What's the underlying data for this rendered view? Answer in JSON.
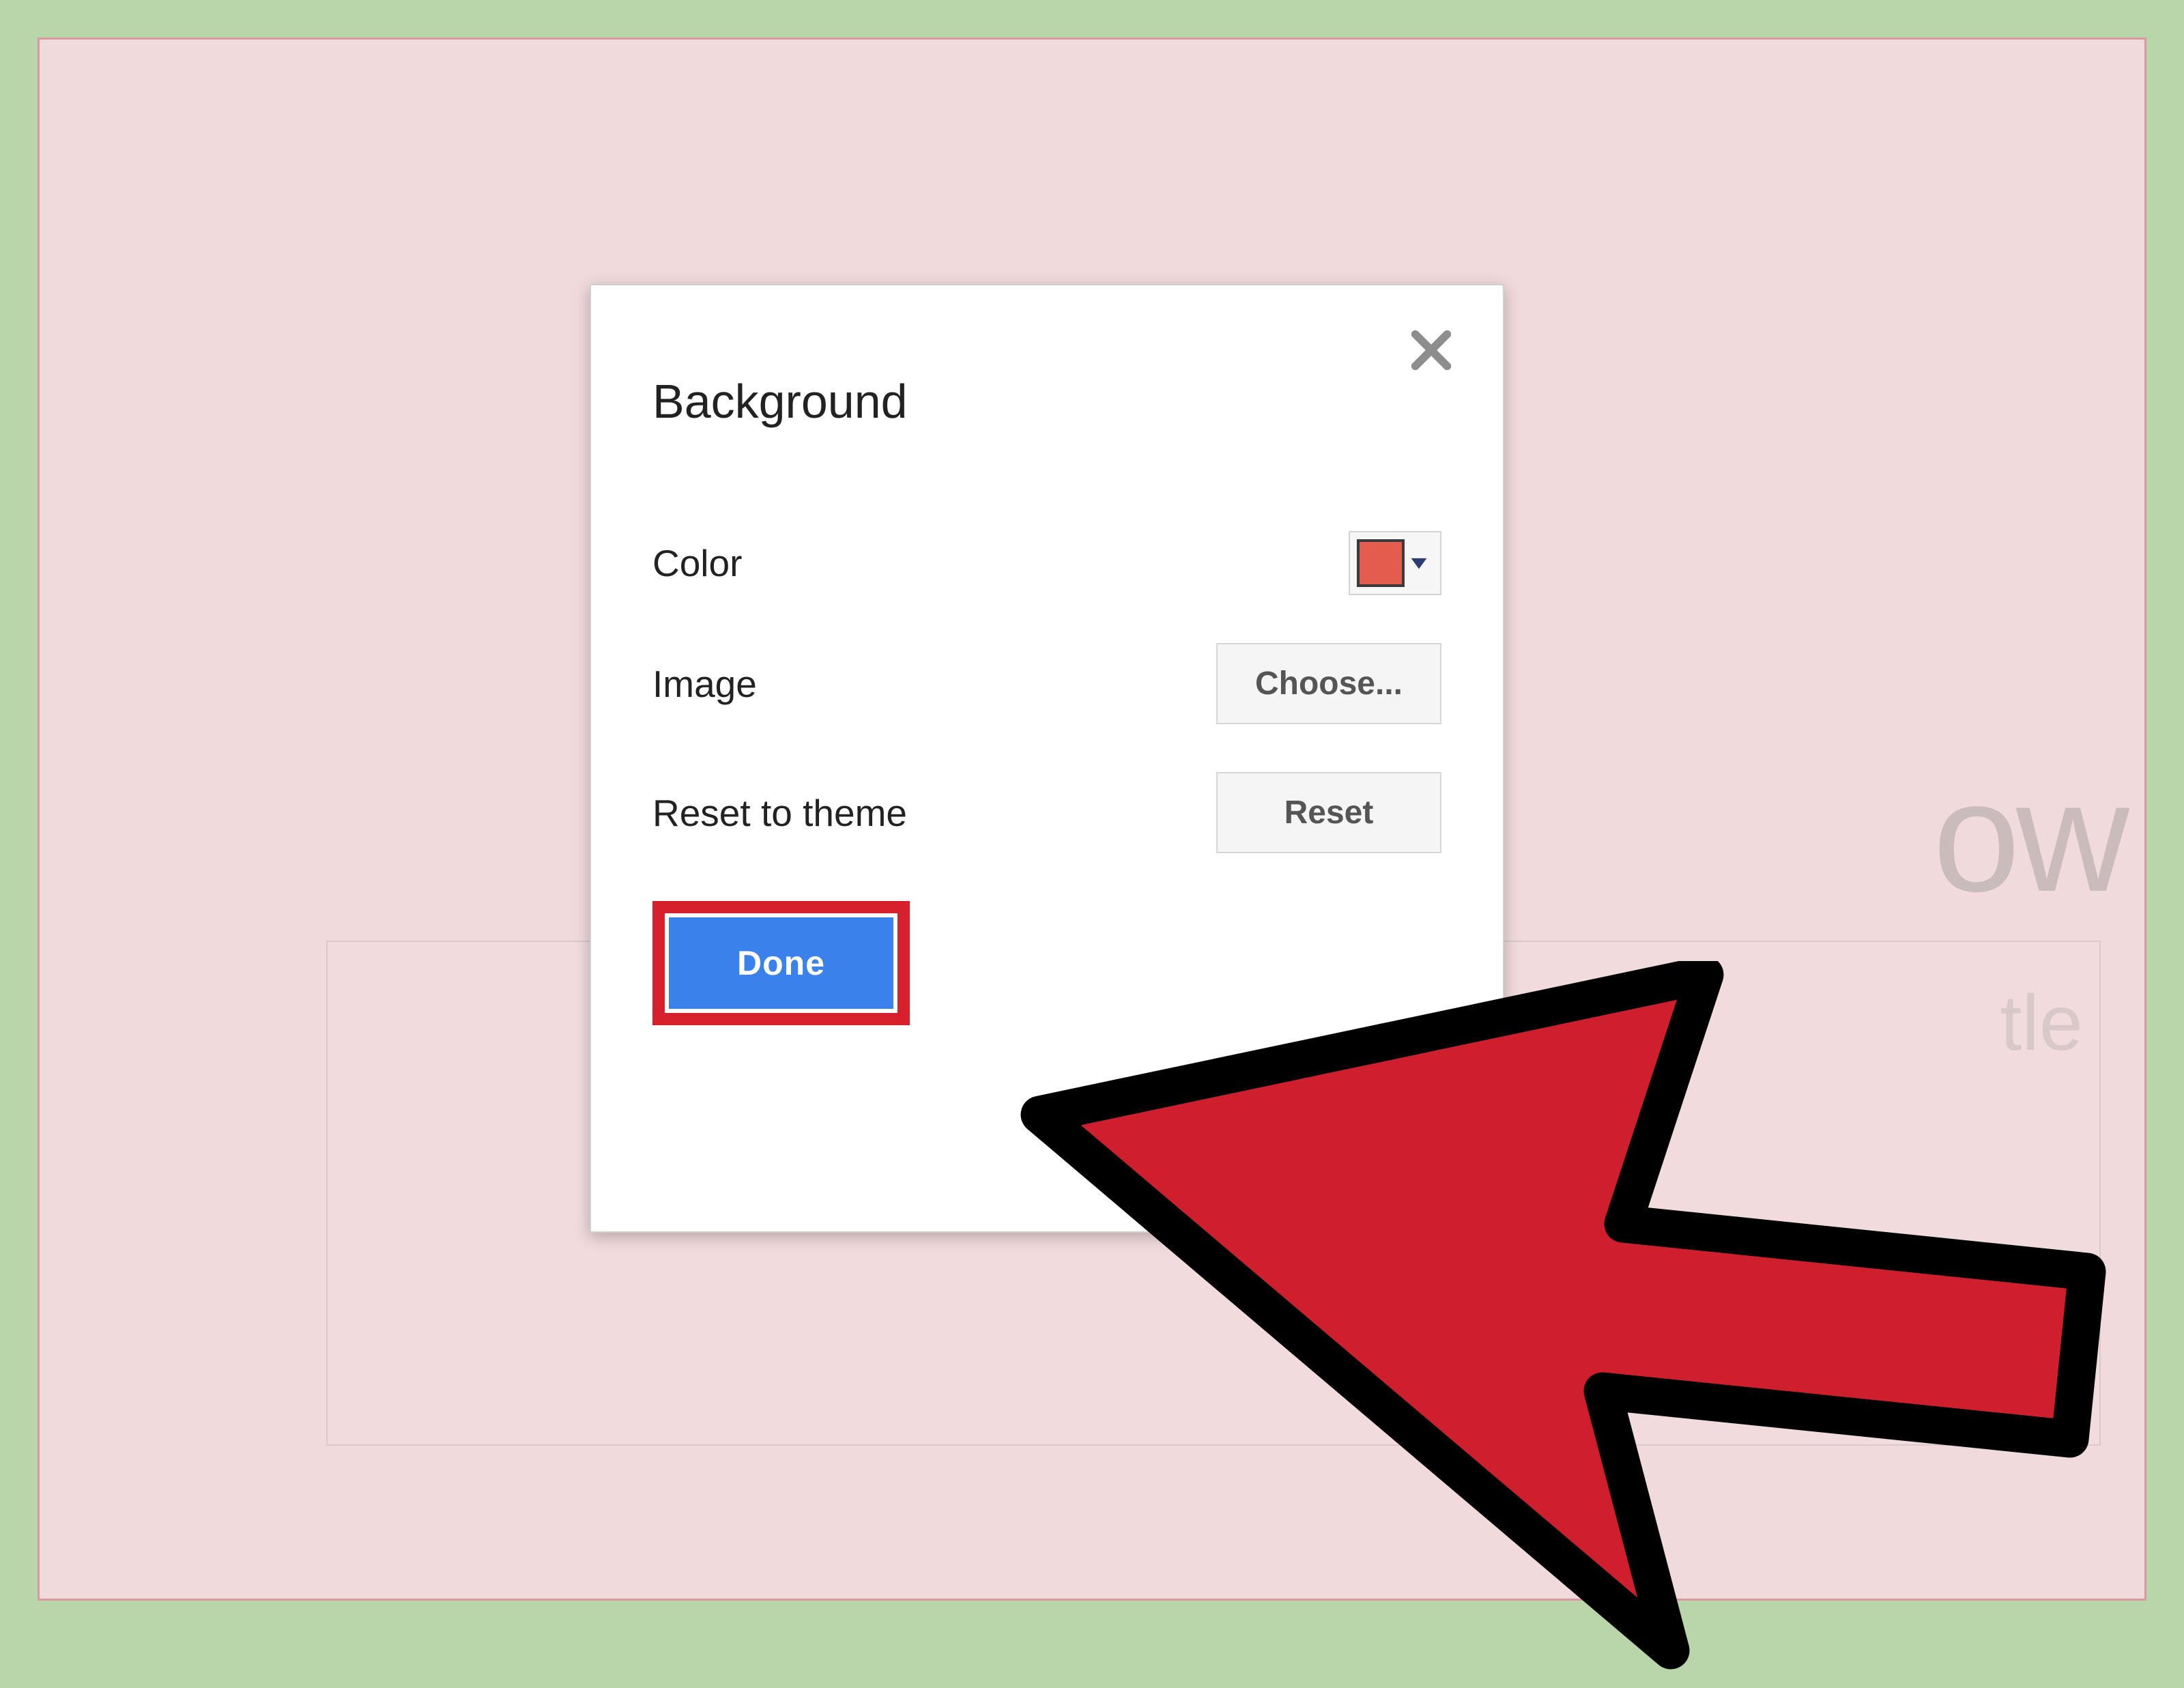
{
  "background_hint_text": "ow",
  "background_sub_text": "tle",
  "dialog": {
    "title": "Background",
    "close_icon": "close-icon",
    "rows": {
      "color": {
        "label": "Color",
        "selected_color": "#e45c4e"
      },
      "image": {
        "label": "Image",
        "button": "Choose..."
      },
      "reset": {
        "label": "Reset to theme",
        "button": "Reset"
      }
    },
    "done_button": "Done"
  }
}
